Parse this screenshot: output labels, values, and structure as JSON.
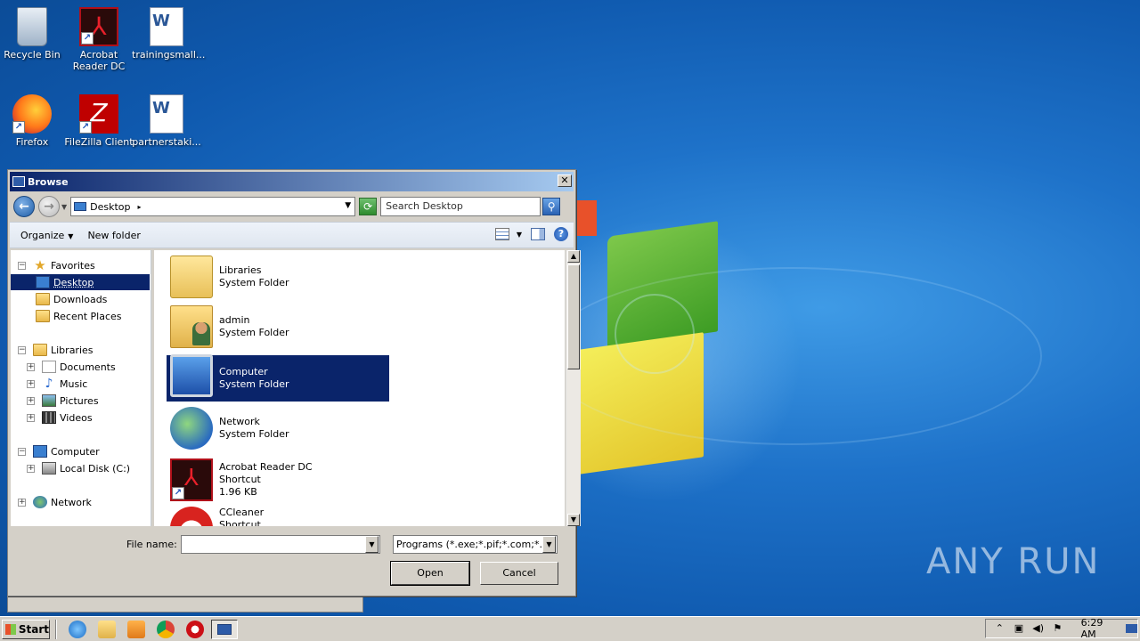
{
  "desktop": {
    "icons": [
      {
        "label": "Recycle Bin",
        "icon": "recycle-bin-icon"
      },
      {
        "label": "Acrobat Reader DC",
        "icon": "acrobat-icon"
      },
      {
        "label": "trainingsmall...",
        "icon": "word-document-icon"
      },
      {
        "label": "Firefox",
        "icon": "firefox-icon"
      },
      {
        "label": "FileZilla Client",
        "icon": "filezilla-icon"
      },
      {
        "label": "partnerstaki...",
        "icon": "word-document-icon"
      }
    ],
    "watermark": "ANY RUN"
  },
  "dialog": {
    "title": "Browse",
    "close_glyph": "✕",
    "address": {
      "location": "Desktop"
    },
    "search": {
      "placeholder": "Search Desktop"
    },
    "toolbar": {
      "organize": "Organize",
      "new_folder": "New folder",
      "help": "?"
    },
    "nav_tree": {
      "favorites": "Favorites",
      "desktop": "Desktop",
      "downloads": "Downloads",
      "recent_places": "Recent Places",
      "libraries": "Libraries",
      "documents": "Documents",
      "music": "Music",
      "pictures": "Pictures",
      "videos": "Videos",
      "computer": "Computer",
      "local_disk": "Local Disk (C:)",
      "network": "Network"
    },
    "files": [
      {
        "name": "Libraries",
        "type": "System Folder",
        "size": ""
      },
      {
        "name": "admin",
        "type": "System Folder",
        "size": ""
      },
      {
        "name": "Computer",
        "type": "System Folder",
        "size": ""
      },
      {
        "name": "Network",
        "type": "System Folder",
        "size": ""
      },
      {
        "name": "Acrobat Reader DC",
        "type": "Shortcut",
        "size": "1.96 KB"
      },
      {
        "name": "CCleaner",
        "type": "Shortcut",
        "size": ""
      }
    ],
    "selected_file": "Computer",
    "filename_label": "File name:",
    "filename_value": "",
    "filetype_value": "Programs (*.exe;*.pif;*.com;*.ba",
    "open_label": "Open",
    "cancel_label": "Cancel"
  },
  "taskbar": {
    "start_label": "Start",
    "clock": "6:29 AM"
  }
}
